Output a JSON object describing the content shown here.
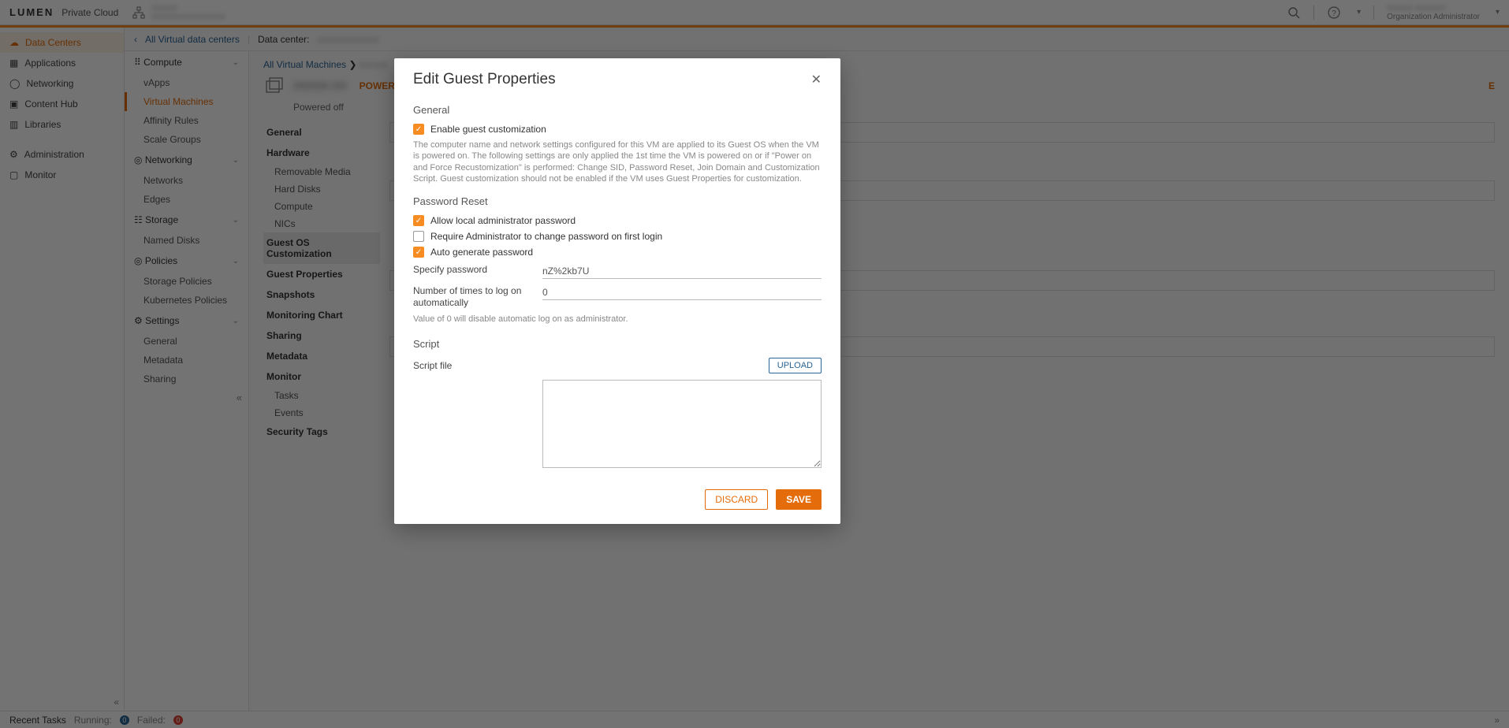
{
  "brand": {
    "name": "LUMEN",
    "sub": "Private Cloud"
  },
  "header": {
    "orgLine1": "xxxxxx",
    "orgLine2": "xxxxxxxxxxxxxxxxx",
    "userLine1": "xxxxxx xxxxxxx",
    "userRole": "Organization Administrator"
  },
  "leftnav": {
    "items": [
      {
        "label": "Data Centers",
        "active": true
      },
      {
        "label": "Applications"
      },
      {
        "label": "Networking"
      },
      {
        "label": "Content Hub"
      },
      {
        "label": "Libraries"
      },
      {
        "label": "Administration"
      },
      {
        "label": "Monitor"
      }
    ]
  },
  "crumb": {
    "back": "All Virtual data centers",
    "dclabel": "Data center:",
    "dcname": "xxxxxxxxxxxxx"
  },
  "secondnav": {
    "groups": [
      {
        "title": "Compute",
        "icon": "grid-icon",
        "items": [
          "vApps",
          "Virtual Machines",
          "Affinity Rules",
          "Scale Groups"
        ],
        "activeIndex": 1
      },
      {
        "title": "Networking",
        "icon": "globe-icon",
        "items": [
          "Networks",
          "Edges"
        ]
      },
      {
        "title": "Storage",
        "icon": "disk-icon",
        "items": [
          "Named Disks"
        ]
      },
      {
        "title": "Policies",
        "icon": "target-icon",
        "items": [
          "Storage Policies",
          "Kubernetes Policies"
        ]
      },
      {
        "title": "Settings",
        "icon": "gear-icon",
        "items": [
          "General",
          "Metadata",
          "Sharing"
        ]
      }
    ]
  },
  "main": {
    "breadcrumb_link": "All Virtual Machines",
    "breadcrumb_leaf": "xxxxxx",
    "vm_name": "xxxxx-xx",
    "power_action": "POWER ON",
    "power_state": "Powered off",
    "extra_e": "E",
    "detailnav": [
      {
        "label": "General",
        "type": "h"
      },
      {
        "label": "Hardware",
        "type": "h"
      },
      {
        "label": "Removable Media",
        "type": "s"
      },
      {
        "label": "Hard Disks",
        "type": "s"
      },
      {
        "label": "Compute",
        "type": "s"
      },
      {
        "label": "NICs",
        "type": "s"
      },
      {
        "label": "Guest OS Customization",
        "type": "h",
        "active": true
      },
      {
        "label": "Guest Properties",
        "type": "h"
      },
      {
        "label": "Snapshots",
        "type": "h"
      },
      {
        "label": "Monitoring Chart",
        "type": "h"
      },
      {
        "label": "Sharing",
        "type": "h"
      },
      {
        "label": "Metadata",
        "type": "h"
      },
      {
        "label": "Monitor",
        "type": "h"
      },
      {
        "label": "Tasks",
        "type": "s"
      },
      {
        "label": "Events",
        "type": "s"
      },
      {
        "label": "Security Tags",
        "type": "h"
      }
    ]
  },
  "recent": {
    "label": "Recent Tasks",
    "running_label": "Running:",
    "running_count": "0",
    "failed_label": "Failed:",
    "failed_count": "0"
  },
  "modal": {
    "title": "Edit Guest Properties",
    "sections": {
      "general": {
        "heading": "General",
        "enable_label": "Enable guest customization",
        "enable_checked": true,
        "help": "The computer name and network settings configured for this VM are applied to its Guest OS when the VM is powered on. The following settings are only applied the 1st time the VM is powered on or if \"Power on and Force Recustomization\" is performed: Change SID, Password Reset, Join Domain and Customization Script. Guest customization should not be enabled if the VM uses Guest Properties for customization."
      },
      "password": {
        "heading": "Password Reset",
        "allow_label": "Allow local administrator password",
        "allow_checked": true,
        "require_label": "Require Administrator to change password on first login",
        "require_checked": false,
        "autogen_label": "Auto generate password",
        "autogen_checked": true,
        "specify_label": "Specify password",
        "specify_value": "nZ%2kb7U",
        "logon_label": "Number of times to log on automatically",
        "logon_value": "0",
        "logon_note": "Value of 0 will disable automatic log on as administrator."
      },
      "script": {
        "heading": "Script",
        "file_label": "Script file",
        "upload_label": "UPLOAD",
        "content": ""
      }
    },
    "discard": "DISCARD",
    "save": "SAVE"
  }
}
